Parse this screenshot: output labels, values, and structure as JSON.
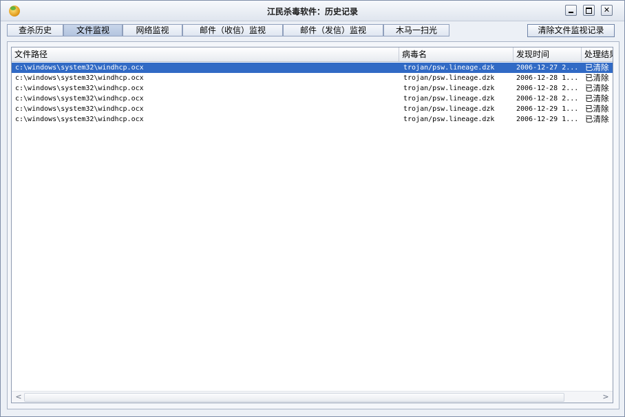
{
  "window": {
    "title": "江民杀毒软件：历史记录"
  },
  "tabs": [
    {
      "label": "查杀历史"
    },
    {
      "label": "文件监视"
    },
    {
      "label": "网络监视"
    },
    {
      "label": "邮件（收信）监视"
    },
    {
      "label": "邮件（发信）监视"
    },
    {
      "label": "木马一扫光"
    }
  ],
  "active_tab": "文件监视",
  "toolbar": {
    "clear_label": "清除文件监视记录"
  },
  "table": {
    "columns": [
      "文件路径",
      "病毒名",
      "发现时间",
      "处理结果"
    ],
    "rows": [
      {
        "path": "c:\\windows\\system32\\windhcp.ocx",
        "virus": "trojan/psw.lineage.dzk",
        "time": "2006-12-27 2...",
        "result": "已清除"
      },
      {
        "path": "c:\\windows\\system32\\windhcp.ocx",
        "virus": "trojan/psw.lineage.dzk",
        "time": "2006-12-28 1...",
        "result": "已清除"
      },
      {
        "path": "c:\\windows\\system32\\windhcp.ocx",
        "virus": "trojan/psw.lineage.dzk",
        "time": "2006-12-28 2...",
        "result": "已清除"
      },
      {
        "path": "c:\\windows\\system32\\windhcp.ocx",
        "virus": "trojan/psw.lineage.dzk",
        "time": "2006-12-28 2...",
        "result": "已清除"
      },
      {
        "path": "c:\\windows\\system32\\windhcp.ocx",
        "virus": "trojan/psw.lineage.dzk",
        "time": "2006-12-29 1...",
        "result": "已清除"
      },
      {
        "path": "c:\\windows\\system32\\windhcp.ocx",
        "virus": "trojan/psw.lineage.dzk",
        "time": "2006-12-29 1...",
        "result": "已清除"
      }
    ],
    "selected_row": 0
  },
  "colors": {
    "selection": "#316ac5",
    "window_bg": "#ecf0f6"
  }
}
